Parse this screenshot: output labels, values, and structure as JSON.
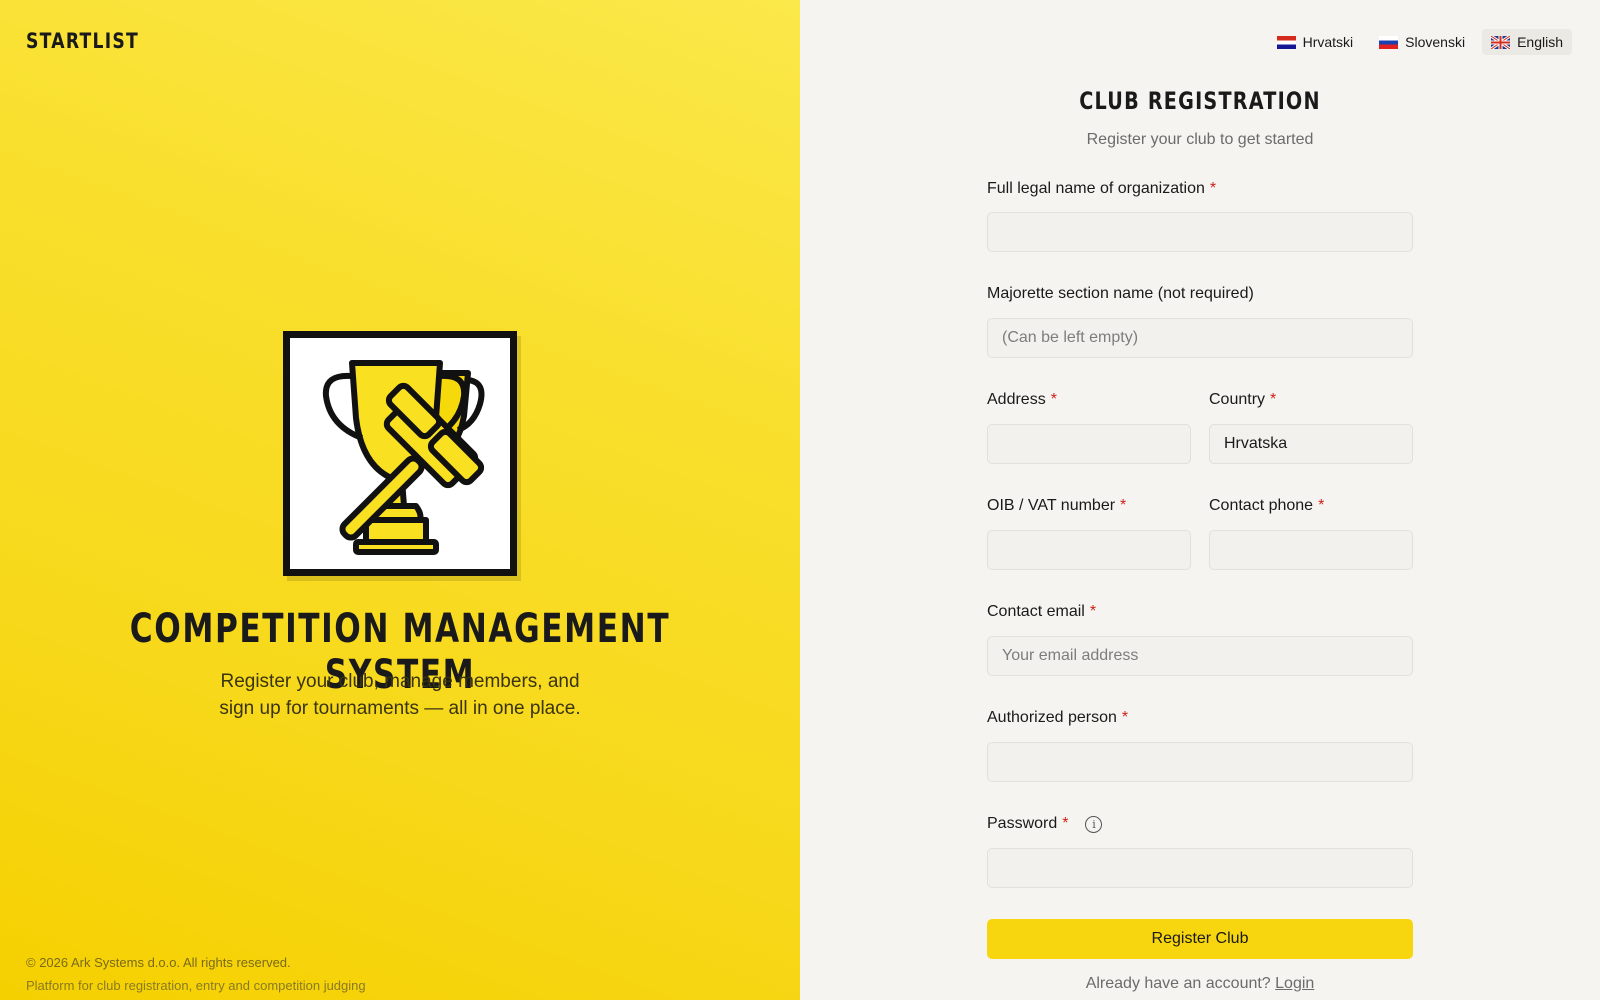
{
  "brand": "STARTLIST",
  "hero": {
    "title": "COMPETITION MANAGEMENT SYSTEM",
    "subtitle_line1": "Register your club, manage members, and",
    "subtitle_line2": "sign up for tournaments — all in one place."
  },
  "footer": {
    "copyright": "© 2026 Ark Systems d.o.o. All rights reserved.",
    "tagline": "Platform for club registration, entry and competition judging"
  },
  "languages": [
    {
      "label": "Hrvatski",
      "flag": "flag-hr"
    },
    {
      "label": "Slovenski",
      "flag": "flag-si"
    },
    {
      "label": "English",
      "flag": "flag-en",
      "active": true
    }
  ],
  "form": {
    "title": "CLUB REGISTRATION",
    "subtitle": "Register your club to get started",
    "required_mark": "*",
    "fields": {
      "org_name": {
        "label": "Full legal name of organization",
        "value": "",
        "placeholder": ""
      },
      "section_name": {
        "label": "Majorette section name (not required)",
        "value": "",
        "placeholder": "(Can be left empty)"
      },
      "address": {
        "label": "Address",
        "value": "",
        "placeholder": ""
      },
      "country": {
        "label": "Country",
        "value": "Hrvatska",
        "placeholder": ""
      },
      "vat": {
        "label": "OIB / VAT number",
        "value": "",
        "placeholder": ""
      },
      "phone": {
        "label": "Contact phone",
        "value": "",
        "placeholder": ""
      },
      "email": {
        "label": "Contact email",
        "value": "",
        "placeholder": "Your email address"
      },
      "authorized": {
        "label": "Authorized person",
        "value": "",
        "placeholder": ""
      },
      "password": {
        "label": "Password",
        "value": "",
        "placeholder": ""
      }
    },
    "submit_label": "Register Club",
    "login_prompt": "Already have an account?",
    "login_link": "Login"
  },
  "colors": {
    "accent": "#f7d610",
    "required": "#d0201a"
  },
  "icons": {
    "logo": "trophy-gavel-icon",
    "password_info": "info-icon"
  }
}
